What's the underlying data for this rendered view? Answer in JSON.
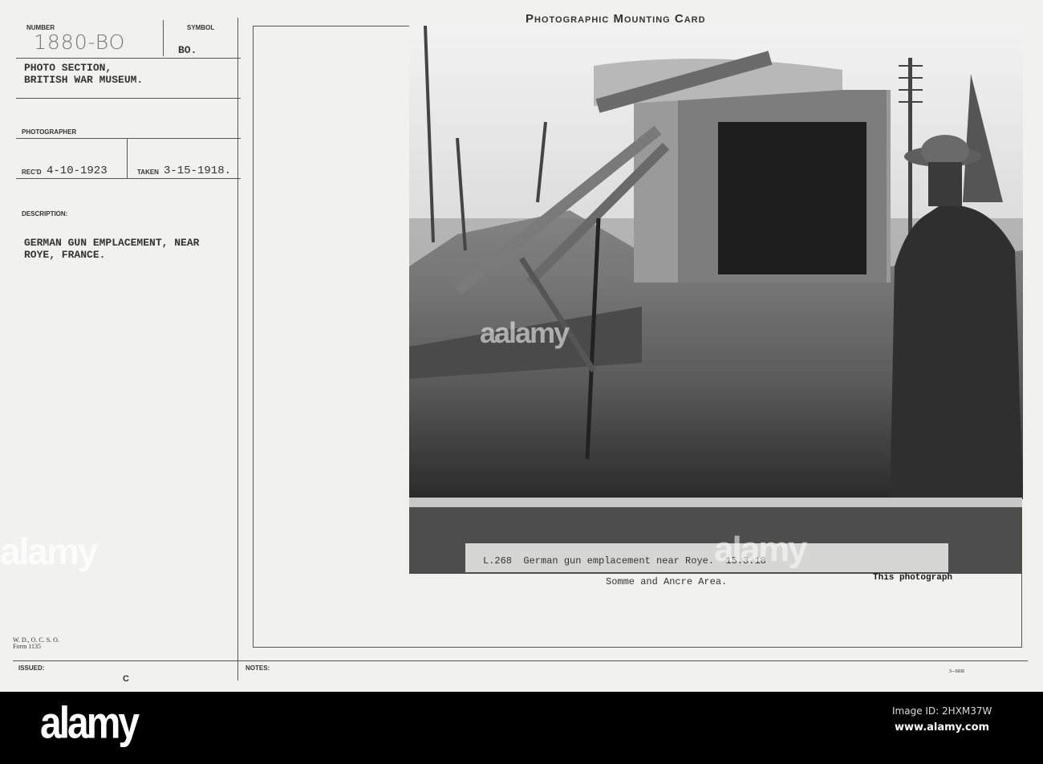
{
  "card_title": "Photographic Mounting Card",
  "fields": {
    "number_label": "NUMBER",
    "number_value": "1880-BO",
    "symbol_label": "SYMBOL",
    "symbol_value": "BO.",
    "section": "PHOTO SECTION,\nBRITISH WAR MUSEUM.",
    "photographer_label": "PHOTOGRAPHER",
    "recd_label": "REC'D",
    "recd_value": "4-10-1923",
    "taken_label": "TAKEN",
    "taken_value": "3-15-1918.",
    "description_label": "DESCRIPTION:",
    "description_value": "GERMAN GUN EMPLACEMENT, NEAR\nROYE, FRANCE.",
    "form_id": "W. D., O. C. S. O.\nForm 1135",
    "issued_label": "ISSUED:",
    "issued_value": "C",
    "notes_label": "NOTES:",
    "print_code": "3—5608"
  },
  "photo_caption": {
    "line1": "L.268  German gun emplacement near Roye.  15.3.18",
    "line2": "Somme and Ancre Area.",
    "trailing": "This photograph"
  },
  "watermark": {
    "logo": "alamy",
    "image_id": "Image ID: 2HXM37W",
    "url": "www.alamy.com"
  }
}
